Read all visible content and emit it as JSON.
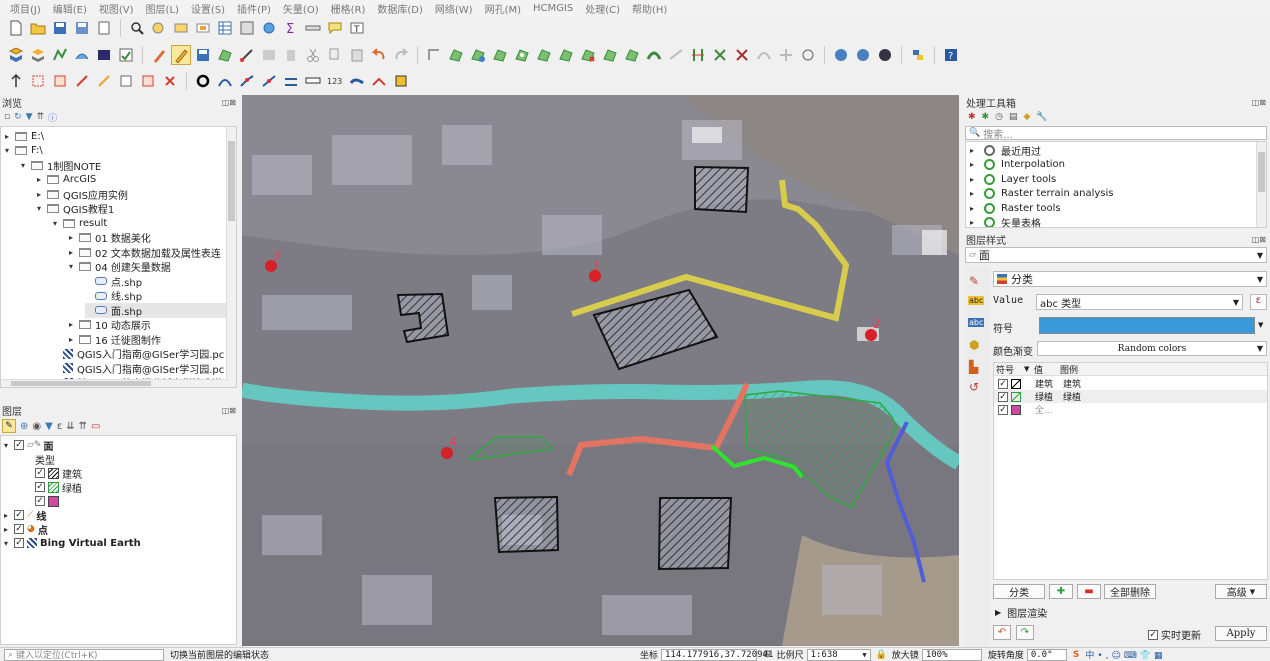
{
  "menubar": [
    "项目(J)",
    "编辑(E)",
    "视图(V)",
    "图层(L)",
    "设置(S)",
    "插件(P)",
    "矢量(O)",
    "栅格(R)",
    "数据库(D)",
    "网络(W)",
    "网孔(M)",
    "HCMGIS",
    "处理(C)",
    "帮助(H)"
  ],
  "browser": {
    "title": "浏览",
    "items": [
      {
        "label": "E:\\",
        "depth": 0,
        "arrow": "▸",
        "kind": "folder"
      },
      {
        "label": "F:\\",
        "depth": 0,
        "arrow": "▾",
        "kind": "folder"
      },
      {
        "label": "1制图NOTE",
        "depth": 1,
        "arrow": "▾",
        "kind": "folder"
      },
      {
        "label": "ArcGIS",
        "depth": 2,
        "arrow": "▸",
        "kind": "folder"
      },
      {
        "label": "QGIS应用实例",
        "depth": 2,
        "arrow": "▸",
        "kind": "folder"
      },
      {
        "label": "QGIS教程1",
        "depth": 2,
        "arrow": "▾",
        "kind": "folder"
      },
      {
        "label": "result",
        "depth": 3,
        "arrow": "▾",
        "kind": "folder"
      },
      {
        "label": "01 数据美化",
        "depth": 4,
        "arrow": "▸",
        "kind": "folder"
      },
      {
        "label": "02 文本数据加载及属性表连",
        "depth": 4,
        "arrow": "▸",
        "kind": "folder"
      },
      {
        "label": "04 创建矢量数据",
        "depth": 4,
        "arrow": "▾",
        "kind": "folder"
      },
      {
        "label": "点.shp",
        "depth": 5,
        "arrow": "",
        "kind": "shp"
      },
      {
        "label": "线.shp",
        "depth": 5,
        "arrow": "",
        "kind": "shp"
      },
      {
        "label": "面.shp",
        "depth": 5,
        "arrow": "",
        "kind": "shp",
        "selected": true
      },
      {
        "label": "10 动态展示",
        "depth": 4,
        "arrow": "▸",
        "kind": "folder"
      },
      {
        "label": "16 迁徙图制作",
        "depth": 4,
        "arrow": "▸",
        "kind": "folder"
      },
      {
        "label": "QGIS入门指南@GISer学习园.pc",
        "depth": 3,
        "arrow": "",
        "kind": "pdf"
      },
      {
        "label": "QGIS入门指南@GISer学习园.pc",
        "depth": 3,
        "arrow": "",
        "kind": "pdf"
      },
      {
        "label": "基于QGIS的空间分析案例技术说",
        "depth": 3,
        "arrow": "",
        "kind": "pdf"
      }
    ]
  },
  "layers": {
    "title": "图层",
    "polygon_layer": "面",
    "field_label": "类型",
    "classes": [
      {
        "label": "建筑",
        "color": "#000000"
      },
      {
        "label": "绿植",
        "color": "#2e9e3e"
      },
      {
        "label": "",
        "color": "#d04aa0"
      }
    ],
    "line_layer": "线",
    "point_layer": "点",
    "basemap": "Bing Virtual Earth"
  },
  "toolbox": {
    "title": "处理工具箱",
    "search_placeholder": "搜索...",
    "items": [
      "最近用过",
      "Interpolation",
      "Layer tools",
      "Raster terrain analysis",
      "Raster tools",
      "矢量表格"
    ]
  },
  "style": {
    "title": "图层样式",
    "layer": "面",
    "renderer": "分类",
    "value_label": "Value",
    "value": "abc 类型",
    "symbol_label": "符号",
    "ramp_label": "颜色渐变",
    "ramp": "Random colors",
    "headers": [
      "符号",
      "值",
      "图例"
    ],
    "rows": [
      {
        "value": "建筑",
        "legend": "建筑",
        "color": "#000000"
      },
      {
        "value": "绿植",
        "legend": "绿植",
        "color": "#2e9e3e"
      },
      {
        "value": "全...",
        "legend": "",
        "color": "#d04aa0"
      }
    ],
    "classify": "分类",
    "delete_all": "全部删除",
    "advanced": "高级",
    "layer_render": "图层渲染",
    "live_update": "实时更新",
    "apply": "Apply",
    "accent": "#3a9ad9"
  },
  "map": {
    "points": [
      "1",
      "2",
      "3",
      "4"
    ]
  },
  "status": {
    "locate_placeholder": "键入以定位(Ctrl+K)",
    "message": "切换当前图层的编辑状态",
    "coord_label": "坐标",
    "coord": "114.177916,37.720941",
    "scale_label": "比例尺",
    "scale": "1:638",
    "magnifier_label": "放大镜",
    "magnifier": "100%",
    "rotation_label": "旋转角度",
    "rotation": "0.0°"
  }
}
